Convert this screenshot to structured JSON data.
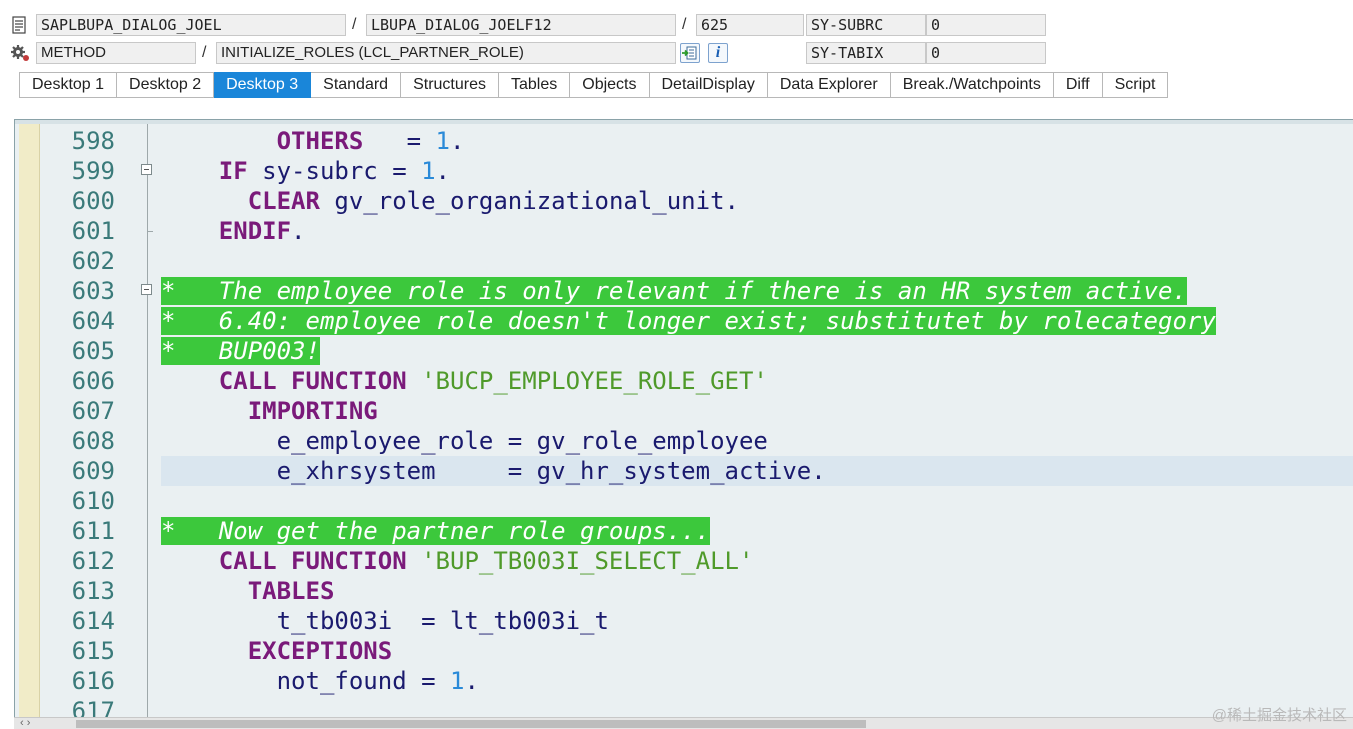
{
  "header": {
    "row1": {
      "program": "SAPLBUPA_DIALOG_JOEL",
      "include": "LBUPA_DIALOG_JOELF12",
      "line": "625",
      "var_name": "SY-SUBRC",
      "var_value": "0"
    },
    "row2": {
      "event_type": "METHOD",
      "event_name": "INITIALIZE_ROLES (LCL_PARTNER_ROLE)",
      "var_name": "SY-TABIX",
      "var_value": "0"
    },
    "separator": "/",
    "info_glyph": "i"
  },
  "tabs": [
    {
      "label": "Desktop 1",
      "active": false
    },
    {
      "label": "Desktop 2",
      "active": false
    },
    {
      "label": "Desktop 3",
      "active": true
    },
    {
      "label": "Standard",
      "active": false
    },
    {
      "label": "Structures",
      "active": false
    },
    {
      "label": "Tables",
      "active": false
    },
    {
      "label": "Objects",
      "active": false
    },
    {
      "label": "DetailDisplay",
      "active": false
    },
    {
      "label": "Data Explorer",
      "active": false
    },
    {
      "label": "Break./Watchpoints",
      "active": false
    },
    {
      "label": "Diff",
      "active": false
    },
    {
      "label": "Script",
      "active": false
    }
  ],
  "code": [
    {
      "n": "598",
      "fold": false,
      "tick": false,
      "comment": false,
      "current": false,
      "parts": [
        {
          "t": "        ",
          "c": "id"
        },
        {
          "t": "OTHERS",
          "c": "kw"
        },
        {
          "t": "   = ",
          "c": "id"
        },
        {
          "t": "1",
          "c": "num"
        },
        {
          "t": ".",
          "c": "id"
        }
      ]
    },
    {
      "n": "599",
      "fold": true,
      "tick": false,
      "comment": false,
      "current": false,
      "parts": [
        {
          "t": "    ",
          "c": "id"
        },
        {
          "t": "IF",
          "c": "kw"
        },
        {
          "t": " sy-subrc = ",
          "c": "id"
        },
        {
          "t": "1",
          "c": "num"
        },
        {
          "t": ".",
          "c": "id"
        }
      ]
    },
    {
      "n": "600",
      "fold": false,
      "tick": false,
      "comment": false,
      "current": false,
      "parts": [
        {
          "t": "      ",
          "c": "id"
        },
        {
          "t": "CLEAR",
          "c": "kw"
        },
        {
          "t": " gv_role_organizational_unit.",
          "c": "id"
        }
      ]
    },
    {
      "n": "601",
      "fold": false,
      "tick": true,
      "comment": false,
      "current": false,
      "parts": [
        {
          "t": "    ",
          "c": "id"
        },
        {
          "t": "ENDIF",
          "c": "kw"
        },
        {
          "t": ".",
          "c": "id"
        }
      ]
    },
    {
      "n": "602",
      "fold": false,
      "tick": false,
      "comment": false,
      "current": false,
      "parts": []
    },
    {
      "n": "603",
      "fold": true,
      "tick": false,
      "comment": true,
      "current": false,
      "parts": [
        {
          "t": "*   The employee role is only relevant if there is an HR system active.",
          "c": "comment"
        }
      ]
    },
    {
      "n": "604",
      "fold": false,
      "tick": false,
      "comment": true,
      "current": false,
      "parts": [
        {
          "t": "*   6.40: employee role doesn't longer exist; substitutet by rolecategory",
          "c": "comment"
        }
      ]
    },
    {
      "n": "605",
      "fold": false,
      "tick": false,
      "comment": true,
      "current": false,
      "parts": [
        {
          "t": "*   BUP003!",
          "c": "comment"
        }
      ]
    },
    {
      "n": "606",
      "fold": false,
      "tick": false,
      "comment": false,
      "current": false,
      "parts": [
        {
          "t": "    ",
          "c": "id"
        },
        {
          "t": "CALL FUNCTION",
          "c": "kw"
        },
        {
          "t": " ",
          "c": "id"
        },
        {
          "t": "'BUCP_EMPLOYEE_ROLE_GET'",
          "c": "str"
        }
      ]
    },
    {
      "n": "607",
      "fold": false,
      "tick": false,
      "comment": false,
      "current": false,
      "parts": [
        {
          "t": "      ",
          "c": "id"
        },
        {
          "t": "IMPORTING",
          "c": "kw"
        }
      ]
    },
    {
      "n": "608",
      "fold": false,
      "tick": false,
      "comment": false,
      "current": false,
      "parts": [
        {
          "t": "        e_employee_role = gv_role_employee",
          "c": "id"
        }
      ]
    },
    {
      "n": "609",
      "fold": false,
      "tick": false,
      "comment": false,
      "current": true,
      "parts": [
        {
          "t": "        e_xhrsystem     = gv_hr_system_active.",
          "c": "id"
        }
      ]
    },
    {
      "n": "610",
      "fold": false,
      "tick": false,
      "comment": false,
      "current": false,
      "parts": []
    },
    {
      "n": "611",
      "fold": false,
      "tick": false,
      "comment": true,
      "current": false,
      "parts": [
        {
          "t": "*   Now get the partner role groups...",
          "c": "comment"
        }
      ]
    },
    {
      "n": "612",
      "fold": false,
      "tick": false,
      "comment": false,
      "current": false,
      "parts": [
        {
          "t": "    ",
          "c": "id"
        },
        {
          "t": "CALL FUNCTION",
          "c": "kw"
        },
        {
          "t": " ",
          "c": "id"
        },
        {
          "t": "'BUP_TB003I_SELECT_ALL'",
          "c": "str"
        }
      ]
    },
    {
      "n": "613",
      "fold": false,
      "tick": false,
      "comment": false,
      "current": false,
      "parts": [
        {
          "t": "      ",
          "c": "id"
        },
        {
          "t": "TABLES",
          "c": "kw"
        }
      ]
    },
    {
      "n": "614",
      "fold": false,
      "tick": false,
      "comment": false,
      "current": false,
      "parts": [
        {
          "t": "        t_tb003i  = lt_tb003i_t",
          "c": "id"
        }
      ]
    },
    {
      "n": "615",
      "fold": false,
      "tick": false,
      "comment": false,
      "current": false,
      "parts": [
        {
          "t": "      ",
          "c": "id"
        },
        {
          "t": "EXCEPTIONS",
          "c": "kw"
        }
      ]
    },
    {
      "n": "616",
      "fold": false,
      "tick": false,
      "comment": false,
      "current": false,
      "parts": [
        {
          "t": "        not_found = ",
          "c": "id"
        },
        {
          "t": "1",
          "c": "num"
        },
        {
          "t": ".",
          "c": "id"
        }
      ]
    },
    {
      "n": "617",
      "fold": false,
      "tick": false,
      "comment": false,
      "current": false,
      "parts": []
    }
  ],
  "scroll_arrows": "‹ ›",
  "watermark": "@稀土掘金技术社区",
  "colors": {
    "active_tab": "#1a86d9",
    "comment_bg": "#3cc83c",
    "keyword": "#7a1a7a",
    "string": "#4f9a2a",
    "number": "#2a8ad8",
    "line_number": "#3a7a7a",
    "editor_bg": "#eaf0f2",
    "current_line": "#dae6ef"
  },
  "icons": {
    "program": "program-doc-icon",
    "event": "gear-icon",
    "navigate": "navigate-to-source-icon",
    "info": "info-icon"
  }
}
